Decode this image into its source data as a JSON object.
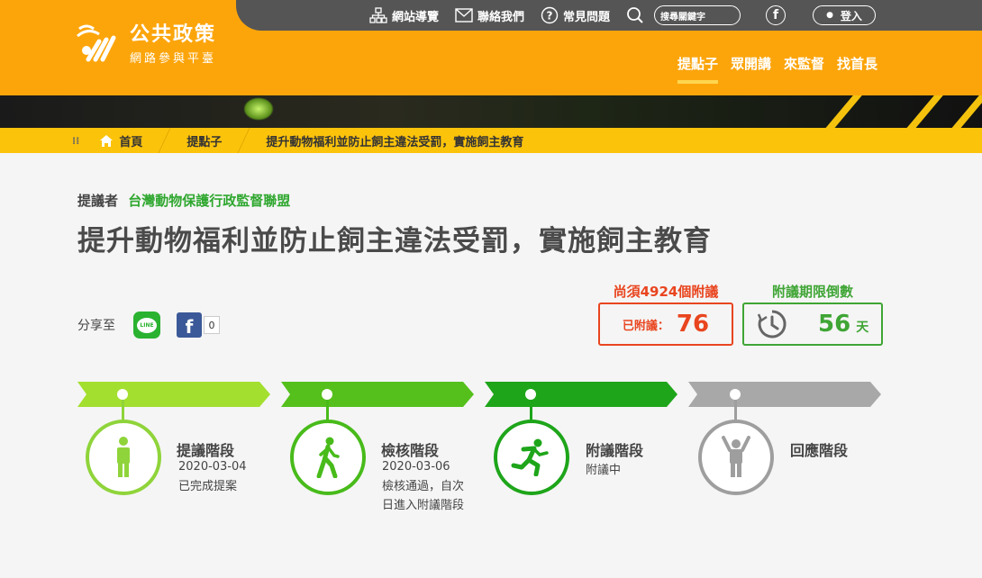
{
  "logo": {
    "title": "公共政策",
    "subtitle": "網路參與平臺"
  },
  "topbar": {
    "sitemap": "網站導覽",
    "contact": "聯絡我們",
    "faq": "常見問題",
    "search_placeholder": "搜尋關鍵字",
    "facebook": "f",
    "login": "登入"
  },
  "mainnav": [
    "提點子",
    "眾開講",
    "來監督",
    "找首長"
  ],
  "breadcrumb": {
    "home": "首頁",
    "section": "提點子",
    "current": "提升動物福利並防止飼主違法受罰，實施飼主教育"
  },
  "proposal": {
    "proposer_label": "提議者",
    "proposer": "台灣動物保護行政監督聯盟",
    "title": "提升動物福利並防止飼主違法受罰，實施飼主教育"
  },
  "share": {
    "label": "分享至",
    "line": "LINE",
    "fb_count": "0"
  },
  "stats": {
    "needed": "尚須4924個附議",
    "signed_label": "已附議：",
    "signed_value": "76",
    "countdown_label": "附議期限倒數",
    "countdown_value": "56",
    "countdown_unit": "天"
  },
  "stages": [
    {
      "name": "提議階段",
      "date": "2020-03-04",
      "desc": "已完成提案",
      "color": "#8fd43a",
      "icon": "standing-person-icon"
    },
    {
      "name": "檢核階段",
      "date": "2020-03-06",
      "desc": "檢核通過，自次",
      "desc2": "日進入附議階段",
      "color": "#48bb1a",
      "icon": "walking-person-icon"
    },
    {
      "name": "附議階段",
      "date": "",
      "desc": "附議中",
      "color": "#1ea51a",
      "icon": "running-person-icon"
    },
    {
      "name": "回應階段",
      "date": "",
      "desc": "",
      "color": "#9e9e9e",
      "icon": "arms-raised-person-icon"
    }
  ],
  "colors": {
    "header": "#fca50b",
    "breadcrumb": "#fcc30b",
    "signed": "#e9451f",
    "countdown": "#3fa535"
  }
}
